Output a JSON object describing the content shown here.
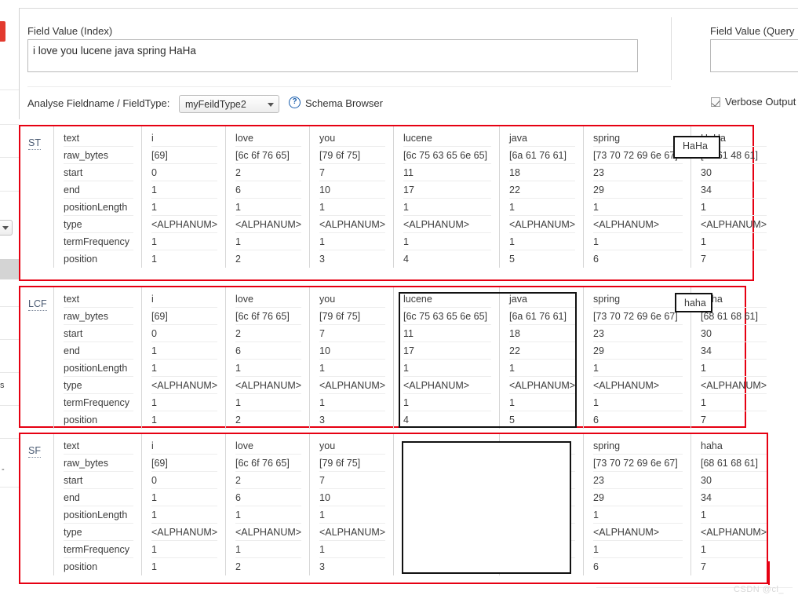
{
  "header": {
    "field_value_index_label": "Field Value (Index)",
    "field_value_index_text": "i love you lucene java spring HaHa",
    "field_value_query_label": "Field Value (Query",
    "field_value_query_text": "",
    "analyse_label": "Analyse Fieldname / FieldType:",
    "fieldtype_selected": "myFeildType2",
    "help_icon_glyph": "?",
    "schema_browser_label": "Schema Browser",
    "verbose_output_label": "Verbose Output",
    "verbose_output_checked": true
  },
  "attributes": [
    "text",
    "raw_bytes",
    "start",
    "end",
    "positionLength",
    "type",
    "termFrequency",
    "position"
  ],
  "sections": [
    {
      "abbr": "ST",
      "tokens": [
        {
          "text": "i",
          "raw_bytes": "[69]",
          "start": "0",
          "end": "1",
          "positionLength": "1",
          "type": "<ALPHANUM>",
          "termFrequency": "1",
          "position": "1"
        },
        {
          "text": "love",
          "raw_bytes": "[6c 6f 76 65]",
          "start": "2",
          "end": "6",
          "positionLength": "1",
          "type": "<ALPHANUM>",
          "termFrequency": "1",
          "position": "2"
        },
        {
          "text": "you",
          "raw_bytes": "[79 6f 75]",
          "start": "7",
          "end": "10",
          "positionLength": "1",
          "type": "<ALPHANUM>",
          "termFrequency": "1",
          "position": "3"
        },
        {
          "text": "lucene",
          "raw_bytes": "[6c 75 63 65 6e 65]",
          "start": "11",
          "end": "17",
          "positionLength": "1",
          "type": "<ALPHANUM>",
          "termFrequency": "1",
          "position": "4"
        },
        {
          "text": "java",
          "raw_bytes": "[6a 61 76 61]",
          "start": "18",
          "end": "22",
          "positionLength": "1",
          "type": "<ALPHANUM>",
          "termFrequency": "1",
          "position": "5"
        },
        {
          "text": "spring",
          "raw_bytes": "[73 70 72 69 6e 67]",
          "start": "23",
          "end": "29",
          "positionLength": "1",
          "type": "<ALPHANUM>",
          "termFrequency": "1",
          "position": "6"
        },
        {
          "text": "HaHa",
          "raw_bytes": "[48 61 48 61]",
          "start": "30",
          "end": "34",
          "positionLength": "1",
          "type": "<ALPHANUM>",
          "termFrequency": "1",
          "position": "7"
        }
      ],
      "highlight_token": "HaHa"
    },
    {
      "abbr": "LCF",
      "tokens": [
        {
          "text": "i",
          "raw_bytes": "[69]",
          "start": "0",
          "end": "1",
          "positionLength": "1",
          "type": "<ALPHANUM>",
          "termFrequency": "1",
          "position": "1"
        },
        {
          "text": "love",
          "raw_bytes": "[6c 6f 76 65]",
          "start": "2",
          "end": "6",
          "positionLength": "1",
          "type": "<ALPHANUM>",
          "termFrequency": "1",
          "position": "2"
        },
        {
          "text": "you",
          "raw_bytes": "[79 6f 75]",
          "start": "7",
          "end": "10",
          "positionLength": "1",
          "type": "<ALPHANUM>",
          "termFrequency": "1",
          "position": "3"
        },
        {
          "text": "lucene",
          "raw_bytes": "[6c 75 63 65 6e 65]",
          "start": "11",
          "end": "17",
          "positionLength": "1",
          "type": "<ALPHANUM>",
          "termFrequency": "1",
          "position": "4"
        },
        {
          "text": "java",
          "raw_bytes": "[6a 61 76 61]",
          "start": "18",
          "end": "22",
          "positionLength": "1",
          "type": "<ALPHANUM>",
          "termFrequency": "1",
          "position": "5"
        },
        {
          "text": "spring",
          "raw_bytes": "[73 70 72 69 6e 67]",
          "start": "23",
          "end": "29",
          "positionLength": "1",
          "type": "<ALPHANUM>",
          "termFrequency": "1",
          "position": "6"
        },
        {
          "text": "haha",
          "raw_bytes": "[68 61 68 61]",
          "start": "30",
          "end": "34",
          "positionLength": "1",
          "type": "<ALPHANUM>",
          "termFrequency": "1",
          "position": "7"
        }
      ],
      "highlight_token": "haha"
    },
    {
      "abbr": "SF",
      "tokens": [
        {
          "text": "i",
          "raw_bytes": "[69]",
          "start": "0",
          "end": "1",
          "positionLength": "1",
          "type": "<ALPHANUM>",
          "termFrequency": "1",
          "position": "1"
        },
        {
          "text": "love",
          "raw_bytes": "[6c 6f 76 65]",
          "start": "2",
          "end": "6",
          "positionLength": "1",
          "type": "<ALPHANUM>",
          "termFrequency": "1",
          "position": "2"
        },
        {
          "text": "you",
          "raw_bytes": "[79 6f 75]",
          "start": "7",
          "end": "10",
          "positionLength": "1",
          "type": "<ALPHANUM>",
          "termFrequency": "1",
          "position": "3"
        },
        {
          "text": "",
          "raw_bytes": "",
          "start": "",
          "end": "",
          "positionLength": "",
          "type": "",
          "termFrequency": "",
          "position": ""
        },
        {
          "text": "",
          "raw_bytes": "",
          "start": "",
          "end": "",
          "positionLength": "",
          "type": "",
          "termFrequency": "",
          "position": ""
        },
        {
          "text": "spring",
          "raw_bytes": "[73 70 72 69 6e 67]",
          "start": "23",
          "end": "29",
          "positionLength": "1",
          "type": "<ALPHANUM>",
          "termFrequency": "1",
          "position": "6"
        },
        {
          "text": "haha",
          "raw_bytes": "[68 61 68 61]",
          "start": "30",
          "end": "34",
          "positionLength": "1",
          "type": "<ALPHANUM>",
          "termFrequency": "1",
          "position": "7"
        }
      ],
      "highlight_token": ""
    }
  ],
  "watermark": "CSDN @cl_",
  "colors": {
    "section_outline": "#e60012",
    "highlight_outline": "#111111"
  }
}
